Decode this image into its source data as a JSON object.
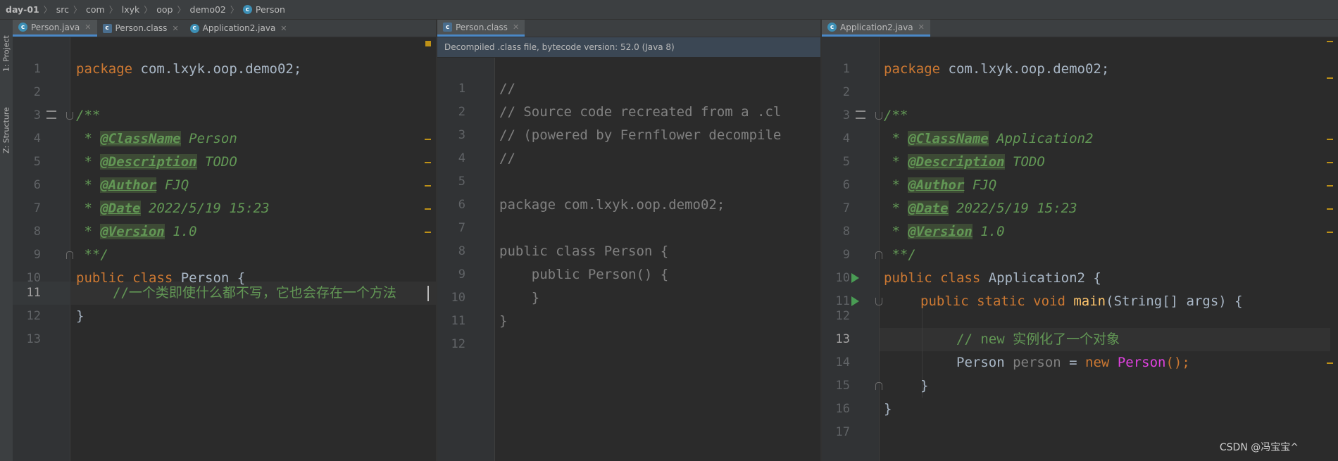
{
  "breadcrumb": [
    "day-01",
    "src",
    "com",
    "lxyk",
    "oop",
    "demo02",
    "Person"
  ],
  "sidebar": {
    "project_label": "1: Project",
    "structure_label": "Z: Structure"
  },
  "left": {
    "tabs": [
      {
        "label": "Person.java",
        "active": true,
        "icon": "class-icon"
      },
      {
        "label": "Person.class",
        "active": false,
        "icon": "compiled-class-icon"
      },
      {
        "label": "Application2.java",
        "active": false,
        "icon": "class-icon"
      }
    ],
    "line_numbers": [
      "1",
      "2",
      "3",
      "4",
      "5",
      "6",
      "7",
      "8",
      "9",
      "10",
      "11",
      "12",
      "13"
    ],
    "code": {
      "l1_kw": "package",
      "l1_rest": " com.lxyk.oop.demo02;",
      "l3": "/**",
      "l4_tag": "@ClassName",
      "l4_val": " Person",
      "l5_tag": "@Description",
      "l5_val": " TODO",
      "l6_tag": "@Author",
      "l6_val": " FJQ",
      "l7_tag": "@Date",
      "l7_val": " 2022/5/19 15:23",
      "l8_tag": "@Version",
      "l8_val": " 1.0",
      "l9": " **/",
      "l10_kw": "public class",
      "l10_rest": " Person {",
      "l11": "//一个类即使什么都不写，它也会存在一个方法",
      "l12": "}"
    }
  },
  "middle": {
    "tab": {
      "label": "Person.class",
      "icon": "compiled-class-icon"
    },
    "banner": "Decompiled .class file, bytecode version: 52.0 (Java 8)",
    "line_numbers": [
      "1",
      "2",
      "3",
      "4",
      "5",
      "6",
      "7",
      "8",
      "9",
      "10",
      "11",
      "12"
    ],
    "code": {
      "l1": "//",
      "l2": "// Source code recreated from a .cl",
      "l3": "// (powered by Fernflower decompile",
      "l4": "//",
      "l6": "package com.lxyk.oop.demo02;",
      "l8": "public class Person {",
      "l9": "    public Person() {",
      "l10": "    }",
      "l11": "}"
    }
  },
  "right": {
    "tab": {
      "label": "Application2.java",
      "icon": "class-icon"
    },
    "line_numbers": [
      "1",
      "2",
      "3",
      "4",
      "5",
      "6",
      "7",
      "8",
      "9",
      "10",
      "11",
      "12",
      "13",
      "14",
      "15",
      "16",
      "17"
    ],
    "code": {
      "l1_kw": "package",
      "l1_rest": " com.lxyk.oop.demo02;",
      "l3": "/**",
      "l4_tag": "@ClassName",
      "l4_val": " Application2",
      "l5_tag": "@Description",
      "l5_val": " TODO",
      "l6_tag": "@Author",
      "l6_val": " FJQ",
      "l7_tag": "@Date",
      "l7_val": " 2022/5/19 15:23",
      "l8_tag": "@Version",
      "l8_val": " 1.0",
      "l9": " **/",
      "l10_kw": "public class",
      "l10_rest": " Application2 {",
      "l11_kw": "public static void",
      "l11_fn": "main",
      "l11_rest": "(String[] args) {",
      "l13": "// new 实例化了一个对象",
      "l14_type": "Person ",
      "l14_var": "person",
      "l14_eq": " = ",
      "l14_new": "new ",
      "l14_ctor": "Person",
      "l14_end": "();",
      "l15": "}",
      "l16": "}"
    }
  },
  "watermark": "CSDN @冯宝宝^"
}
